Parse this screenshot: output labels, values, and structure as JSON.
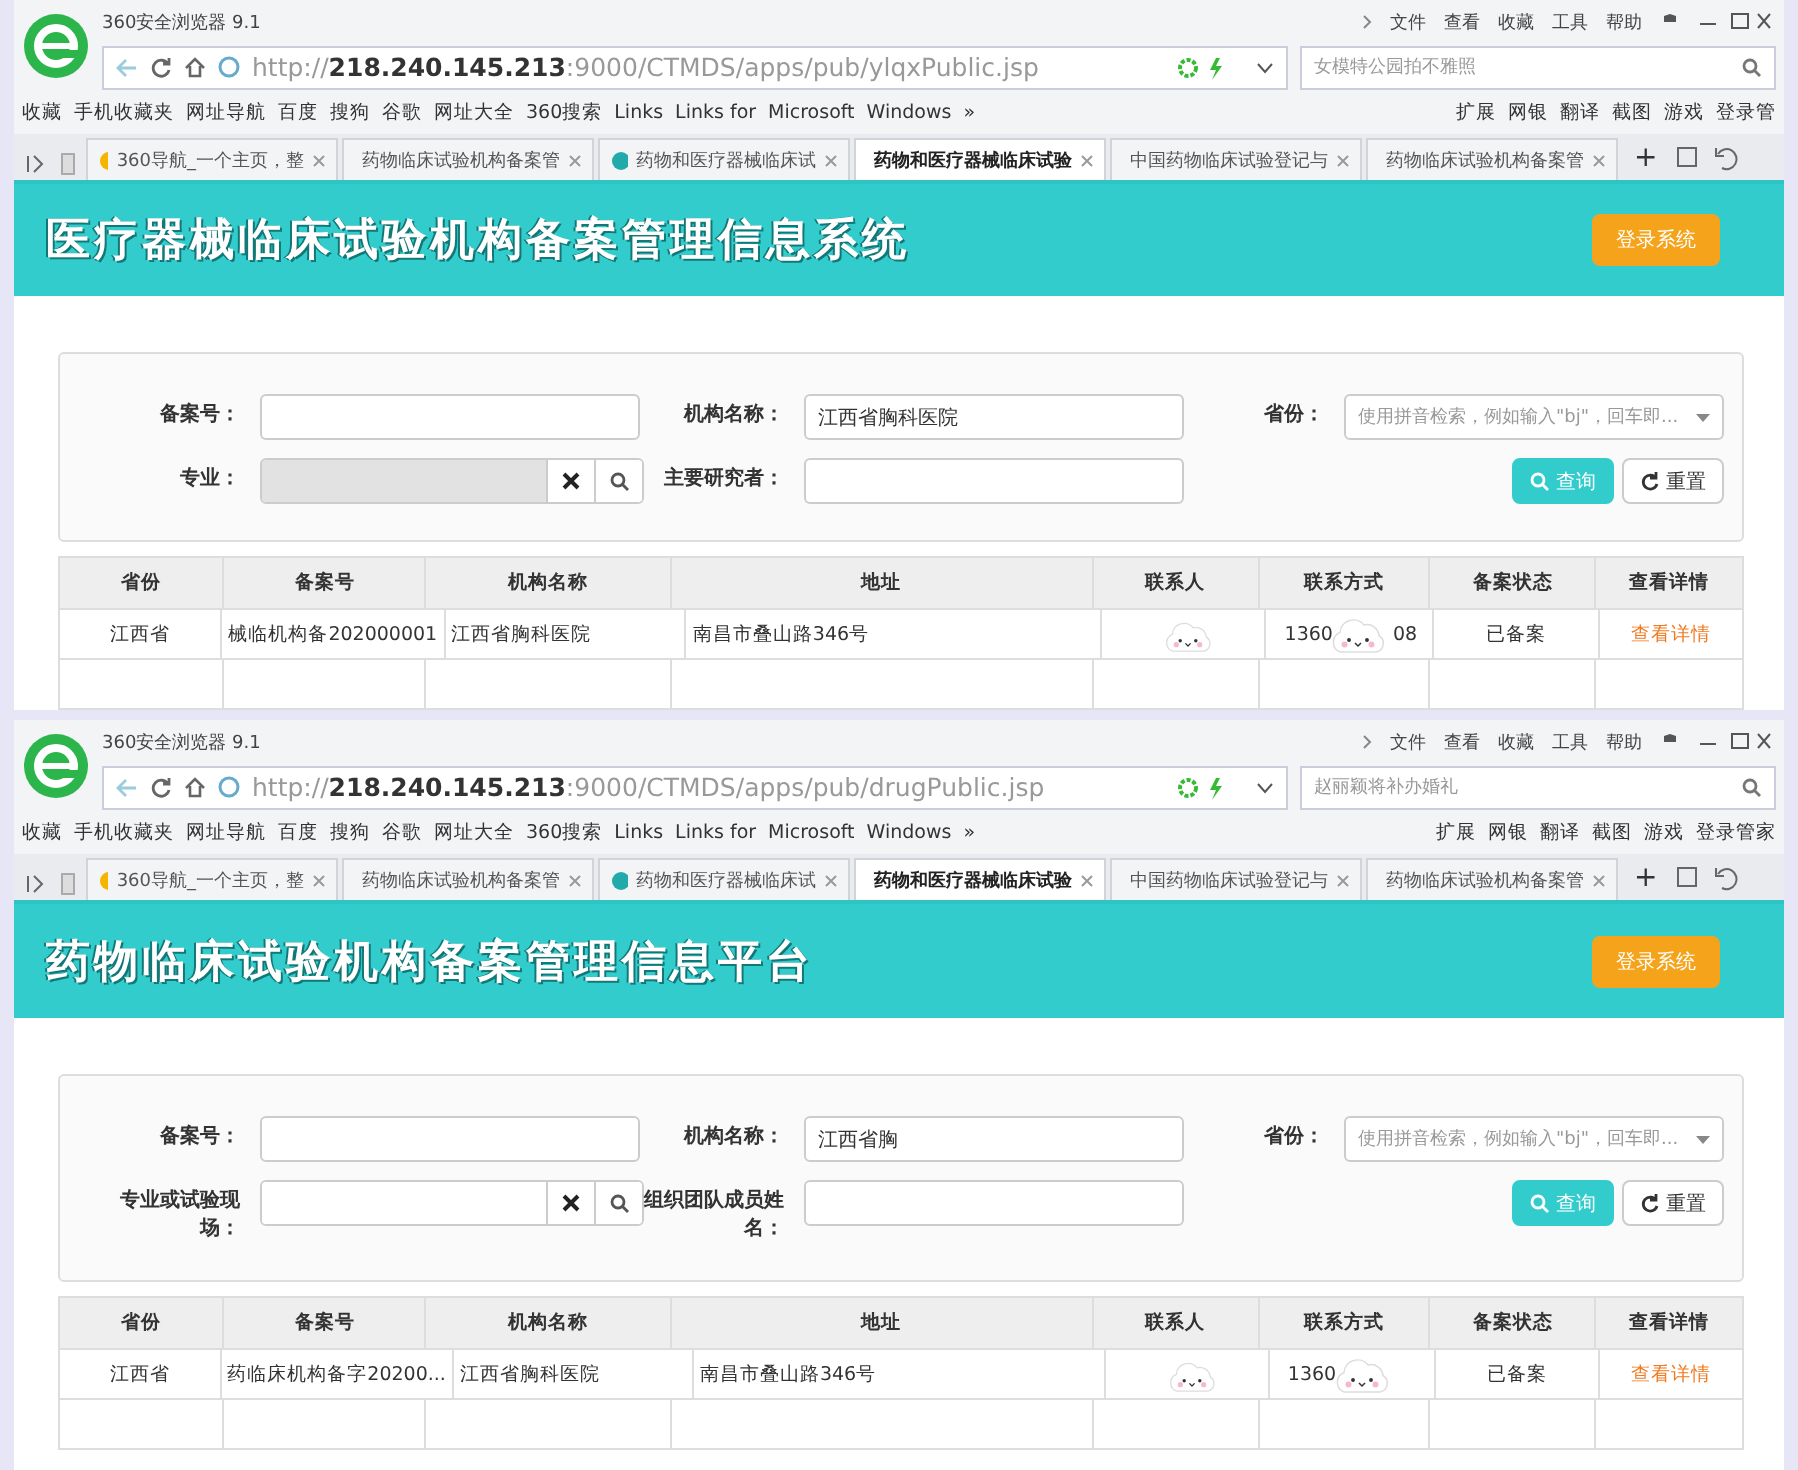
{
  "panels": [
    {
      "browser_name": "360安全浏览器 9.1",
      "menu": [
        "文件",
        "查看",
        "收藏",
        "工具",
        "帮助"
      ],
      "url": {
        "scheme": "http://",
        "host": "218.240.145.213",
        "path": ":9000/CTMDS/apps/pub/ylqxPublic.jsp"
      },
      "search_hint": "女模特公园拍不雅照",
      "bookmarks_left": [
        "收藏",
        "手机收藏夹",
        "网址导航",
        "百度",
        "搜狗",
        "谷歌",
        "网址大全",
        "360搜索",
        "Links",
        "Links for",
        "Microsoft",
        "Windows"
      ],
      "bookmarks_more": "»",
      "bookmarks_right": [
        "扩展",
        "网银",
        "翻译",
        "截图",
        "游戏",
        "登录管"
      ],
      "tabs": [
        {
          "label": "360导航_一个主页，整",
          "selected": false
        },
        {
          "label": "药物临床试验机构备案管",
          "selected": false
        },
        {
          "label": "药物和医疗器械临床试",
          "selected": false
        },
        {
          "label": "药物和医疗器械临床试验",
          "selected": true
        },
        {
          "label": "中国药物临床试验登记与",
          "selected": false
        },
        {
          "label": "药物临床试验机构备案管",
          "selected": false
        }
      ],
      "tab_add": "+",
      "site_title": "医疗器械临床试验机构备案管理信息系统",
      "login_button": "登录系统",
      "fields": [
        {
          "kind": "text",
          "label": "备案号："
        },
        {
          "kind": "text",
          "label": "机构名称：",
          "value": "江西省胸科医院"
        },
        {
          "kind": "select",
          "label": "省份：",
          "placeholder": "使用拼音检索，例如输入\"bj\"，回车即..."
        },
        {
          "kind": "picker",
          "label": "专业：",
          "disabled": true
        },
        {
          "kind": "text",
          "label": "主要研究者："
        }
      ],
      "search_button": "查询",
      "reset_button": "重置",
      "columns": [
        "省份",
        "备案号",
        "机构名称",
        "地址",
        "联系人",
        "联系方式",
        "备案状态",
        "查看详情"
      ],
      "rows": [
        {
          "province": "江西省",
          "record_no": "械临机构备202000001",
          "institution": "江西省胸科医院",
          "address": "南昌市叠山路346号",
          "phone_start": "1360",
          "phone_end": "08",
          "status": "已备案",
          "details_link": "查看详情"
        }
      ]
    },
    {
      "browser_name": "360安全浏览器 9.1",
      "menu": [
        "文件",
        "查看",
        "收藏",
        "工具",
        "帮助"
      ],
      "url": {
        "scheme": "http://",
        "host": "218.240.145.213",
        "path": ":9000/CTMDS/apps/pub/drugPublic.jsp"
      },
      "search_hint": "赵丽颖将补办婚礼",
      "bookmarks_left": [
        "收藏",
        "手机收藏夹",
        "网址导航",
        "百度",
        "搜狗",
        "谷歌",
        "网址大全",
        "360搜索",
        "Links",
        "Links for",
        "Microsoft",
        "Windows"
      ],
      "bookmarks_more": "»",
      "bookmarks_right": [
        "扩展",
        "网银",
        "翻译",
        "截图",
        "游戏",
        "登录管家"
      ],
      "tabs": [
        {
          "label": "360导航_一个主页，整",
          "selected": false
        },
        {
          "label": "药物临床试验机构备案管",
          "selected": false
        },
        {
          "label": "药物和医疗器械临床试",
          "selected": false
        },
        {
          "label": "药物和医疗器械临床试验",
          "selected": true
        },
        {
          "label": "中国药物临床试验登记与",
          "selected": false
        },
        {
          "label": "药物临床试验机构备案管",
          "selected": false
        }
      ],
      "tab_add": "+",
      "site_title": "药物临床试验机构备案管理信息平台",
      "login_button": "登录系统",
      "fields": [
        {
          "kind": "text",
          "label": "备案号："
        },
        {
          "kind": "text",
          "label": "机构名称：",
          "value": "江西省胸"
        },
        {
          "kind": "select",
          "label": "省份：",
          "placeholder": "使用拼音检索，例如输入\"bj\"，回车即..."
        },
        {
          "kind": "picker",
          "label": "专业或试验现场：",
          "disabled": false
        },
        {
          "kind": "text",
          "label": "组织团队成员姓名："
        }
      ],
      "search_button": "查询",
      "reset_button": "重置",
      "columns": [
        "省份",
        "备案号",
        "机构名称",
        "地址",
        "联系人",
        "联系方式",
        "备案状态",
        "查看详情"
      ],
      "rows": [
        {
          "province": "江西省",
          "record_no": "药临床机构备字20200...",
          "institution": "江西省胸科医院",
          "address": "南昌市叠山路346号",
          "phone_start": "1360",
          "phone_end": "",
          "status": "已备案",
          "details_link": "查看详情"
        }
      ]
    }
  ]
}
